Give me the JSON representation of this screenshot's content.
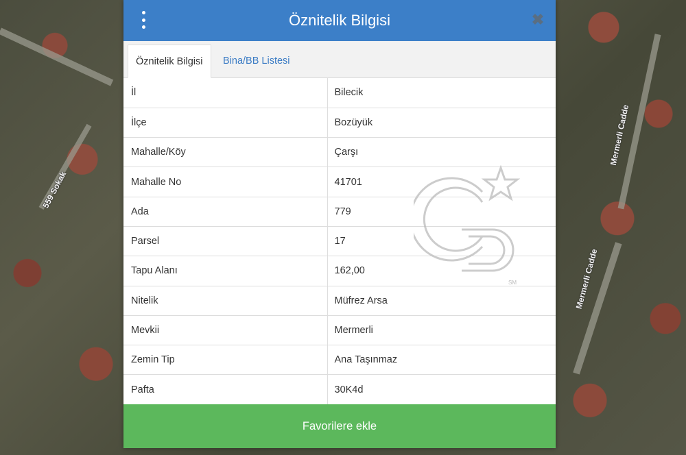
{
  "map": {
    "streets": [
      "559 Sokak",
      "Mermerli Cadde",
      "Mermerli Cadde"
    ]
  },
  "header": {
    "title": "Öznitelik Bilgisi",
    "close_symbol": "✖",
    "accent_color": "#3c7fc8"
  },
  "tabs": [
    {
      "label": "Öznitelik Bilgisi",
      "active": true
    },
    {
      "label": "Bina/BB Listesi",
      "active": false
    }
  ],
  "attributes": [
    {
      "key": "İl",
      "value": "Bilecik"
    },
    {
      "key": "İlçe",
      "value": "Bozüyük"
    },
    {
      "key": "Mahalle/Köy",
      "value": "Çarşı"
    },
    {
      "key": "Mahalle No",
      "value": "41701"
    },
    {
      "key": "Ada",
      "value": "779"
    },
    {
      "key": "Parsel",
      "value": "17"
    },
    {
      "key": "Tapu Alanı",
      "value": "162,00"
    },
    {
      "key": "Nitelik",
      "value": "Müfrez Arsa"
    },
    {
      "key": "Mevkii",
      "value": "Mermerli"
    },
    {
      "key": "Zemin Tip",
      "value": "Ana Taşınmaz"
    },
    {
      "key": "Pafta",
      "value": "30K4d"
    }
  ],
  "footer": {
    "favorite_label": "Favorilere ekle",
    "button_color": "#5cb85c"
  },
  "watermark": {
    "text": "SM"
  }
}
